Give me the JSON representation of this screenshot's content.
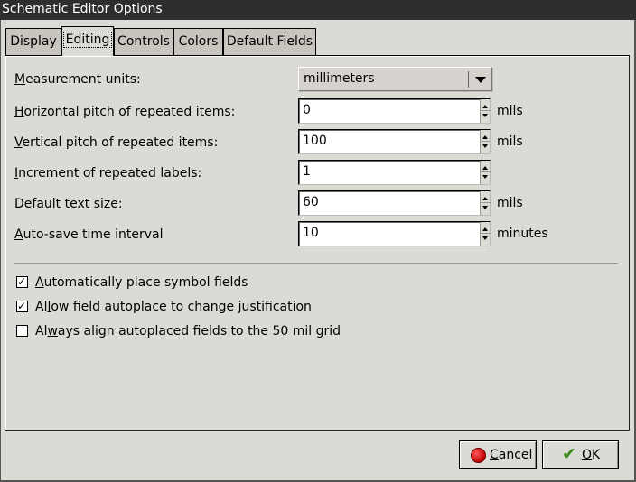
{
  "window": {
    "title": "Schematic Editor Options"
  },
  "tabs": [
    {
      "label": "Display",
      "active": false
    },
    {
      "label": "Editing",
      "active": true
    },
    {
      "label": "Controls",
      "active": false
    },
    {
      "label": "Colors",
      "active": false
    },
    {
      "label": "Default Fields",
      "active": false
    }
  ],
  "fields": {
    "measurement_units": {
      "label_ul": "M",
      "label_rest": "easurement units:",
      "value": "millimeters"
    },
    "horizontal_pitch": {
      "label_pre": "",
      "label_ul": "H",
      "label_rest": "orizontal pitch of repeated items:",
      "value": "0",
      "unit": "mils"
    },
    "vertical_pitch": {
      "label_pre": "",
      "label_ul": "V",
      "label_rest": "ertical pitch of repeated items:",
      "value": "100",
      "unit": "mils"
    },
    "increment_labels": {
      "label_pre": "",
      "label_ul": "I",
      "label_rest": "ncrement of repeated labels:",
      "value": "1"
    },
    "default_text_size": {
      "label_pre": "Def",
      "label_ul": "a",
      "label_rest": "ult text size:",
      "value": "60",
      "unit": "mils"
    },
    "autosave_interval": {
      "label_pre": "",
      "label_ul": "A",
      "label_rest": "uto-save time interval",
      "value": "10",
      "unit": "minutes"
    }
  },
  "checkboxes": [
    {
      "pre": "",
      "ul": "A",
      "rest": "utomatically place symbol fields",
      "checked": true
    },
    {
      "pre": "Al",
      "ul": "l",
      "rest": "ow field autoplace to change justification",
      "checked": true
    },
    {
      "pre": "Al",
      "ul": "w",
      "rest": "ays align autoplaced fields to the 50 mil grid",
      "checked": false
    }
  ],
  "buttons": {
    "cancel": {
      "ul": "C",
      "rest": "ancel",
      "icon": "cancel-icon"
    },
    "ok": {
      "ul": "O",
      "rest": "K",
      "icon": "checkmark-icon"
    }
  },
  "colors": {
    "titlebar": "#2e2e2e",
    "background": "#dcdad5",
    "inactive_tab": "#c8c5bf"
  }
}
